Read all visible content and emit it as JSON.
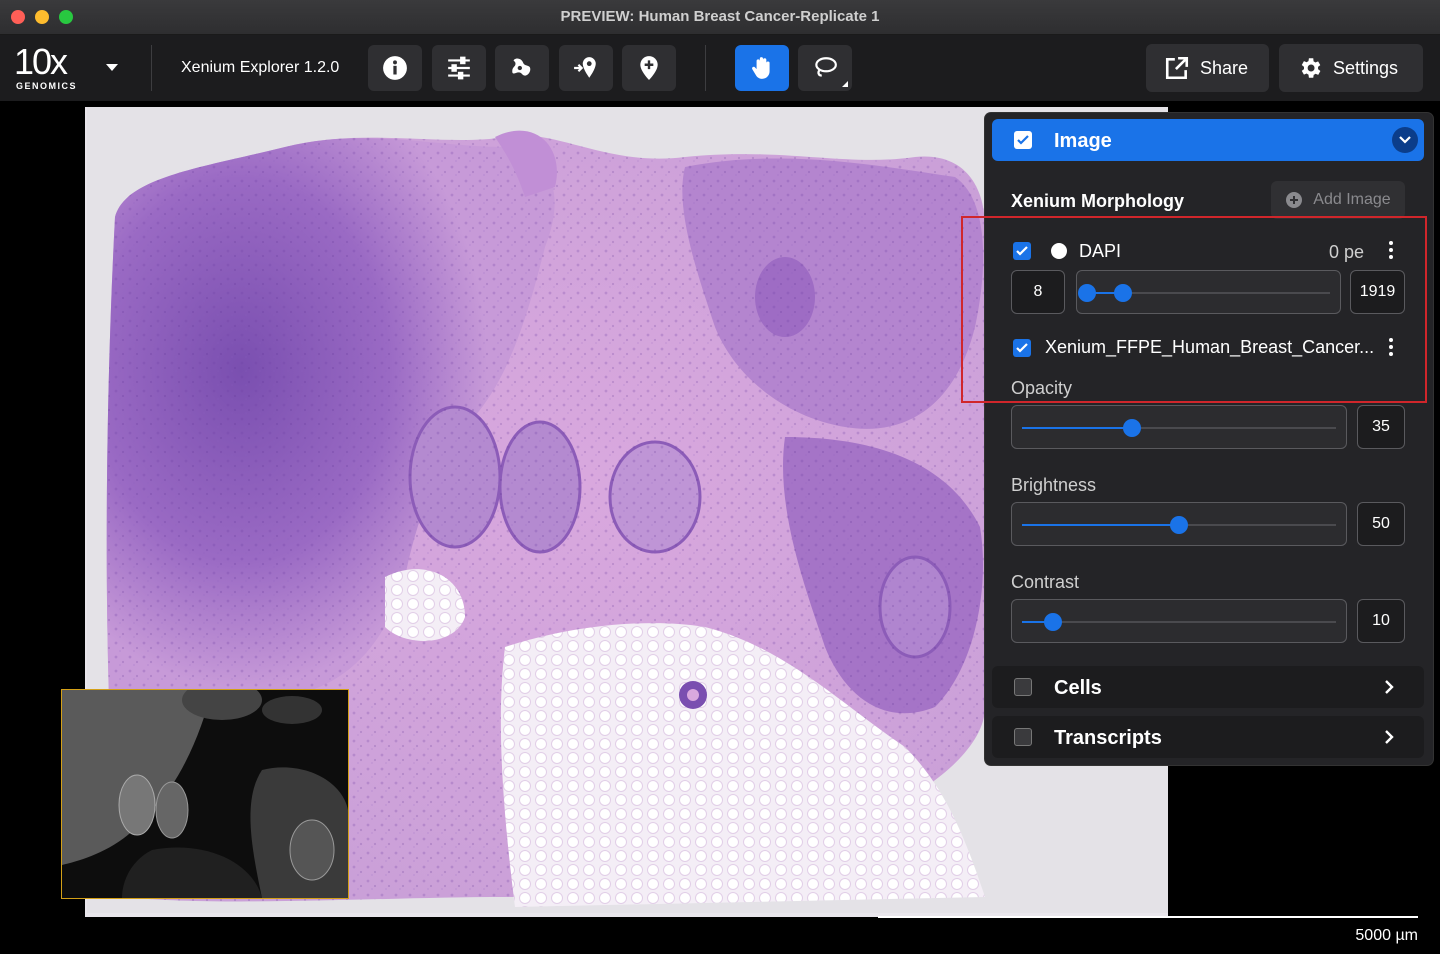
{
  "window": {
    "title": "PREVIEW: Human Breast Cancer-Replicate 1"
  },
  "logo": {
    "mark": "10x",
    "brand": "GENOMICS"
  },
  "toolbar": {
    "app_name": "Xenium Explorer 1.2.0",
    "tools": [
      "info-icon",
      "sliders-icon",
      "region-icon",
      "add-point-icon",
      "pin-icon",
      "hand-icon",
      "lasso-icon"
    ],
    "active_tool": "hand-icon",
    "share_label": "Share",
    "settings_label": "Settings"
  },
  "viewer": {
    "scale_label": "5000 µm"
  },
  "panel": {
    "image_section": {
      "label": "Image",
      "checked": true,
      "expanded": true,
      "group_title": "Xenium Morphology",
      "add_image_label": "Add Image",
      "dapi": {
        "checked": true,
        "label": "DAPI",
        "value_label": "0 pe",
        "min": "8",
        "max": "1919",
        "range_low": 0.0,
        "range_high": 0.15
      },
      "he_image": {
        "checked": true,
        "label": "Xenium_FFPE_Human_Breast_Cancer..."
      },
      "opacity": {
        "label": "Opacity",
        "value": "35",
        "fraction": 0.35
      },
      "brightness": {
        "label": "Brightness",
        "value": "50",
        "fraction": 0.5
      },
      "contrast": {
        "label": "Contrast",
        "value": "10",
        "fraction": 0.1
      }
    },
    "cells": {
      "label": "Cells",
      "checked": false
    },
    "transcripts": {
      "label": "Transcripts",
      "checked": false
    }
  },
  "colors": {
    "accent": "#1a73e8",
    "highlight_box": "#d0262b",
    "inset_border": "#d4a017",
    "tissue_dark": "#7a4fb0",
    "tissue_light": "#d9a8de"
  }
}
